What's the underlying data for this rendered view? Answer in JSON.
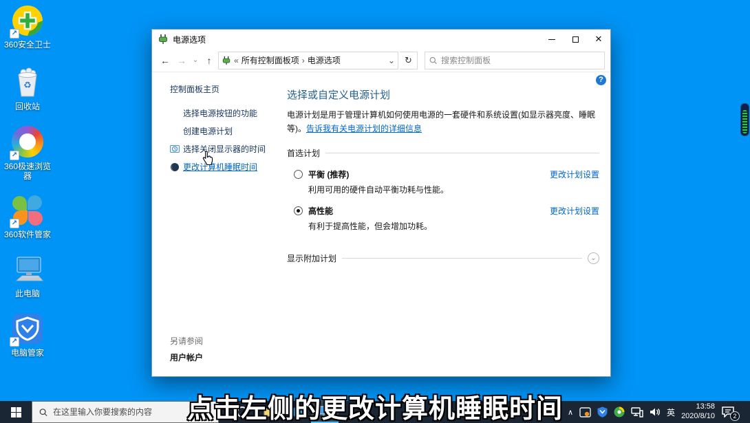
{
  "subtitle": "点击左侧的更改计算机睡眠时间",
  "desktop": {
    "icons": [
      {
        "label": "360安全卫士"
      },
      {
        "label": "回收站"
      },
      {
        "label": "360极速浏览器"
      },
      {
        "label": "360软件管家"
      },
      {
        "label": "此电脑"
      },
      {
        "label": "电脑管家"
      }
    ]
  },
  "glyphs": {
    "back": "←",
    "forward": "→",
    "dropdown": "⌄",
    "up": "↑",
    "refresh": "↻",
    "guillemet": "«",
    "crumb_sep": "›",
    "address_dropdown": "⌄",
    "help": "?",
    "expand": "⌄",
    "minimize": "–",
    "close": "✕",
    "tray_chevron": "∧",
    "recycle": "♻"
  },
  "window": {
    "title": "电源选项",
    "nav": {
      "crumb1": "所有控制面板项",
      "crumb2": "电源选项",
      "search_placeholder": "搜索控制面板"
    },
    "sidebar": {
      "home": "控制面板主页",
      "tasks": [
        {
          "label": "选择电源按钮的功能"
        },
        {
          "label": "创建电源计划"
        },
        {
          "label": "选择关闭显示器的时间"
        },
        {
          "label": "更改计算机睡眠时间"
        }
      ],
      "see_also": "另请参阅",
      "user_accounts": "用户帐户"
    },
    "main": {
      "heading": "选择或自定义电源计划",
      "intro": "电源计划是用于管理计算机如何使用电源的一套硬件和系统设置(如显示器亮度、睡眠等)。",
      "intro_link": "告诉我有关电源计划的详细信息",
      "preferred_label": "首选计划",
      "plans": [
        {
          "name": "平衡 (推荐)",
          "desc": "利用可用的硬件自动平衡功耗与性能。",
          "action": "更改计划设置",
          "selected": false
        },
        {
          "name": "高性能",
          "desc": "有利于提高性能，但会增加功耗。",
          "action": "更改计划设置",
          "selected": true
        }
      ],
      "additional_label": "显示附加计划"
    }
  },
  "taskbar": {
    "search_placeholder": "在这里输入你要搜索的内容",
    "tray": {
      "ime": "英",
      "time": "13:58",
      "date": "2020/8/10",
      "notification_count": "2"
    }
  },
  "colors": {
    "desktop_blue": "#0094f6",
    "link_blue": "#0066cc",
    "taskbar": "#1a2634"
  }
}
